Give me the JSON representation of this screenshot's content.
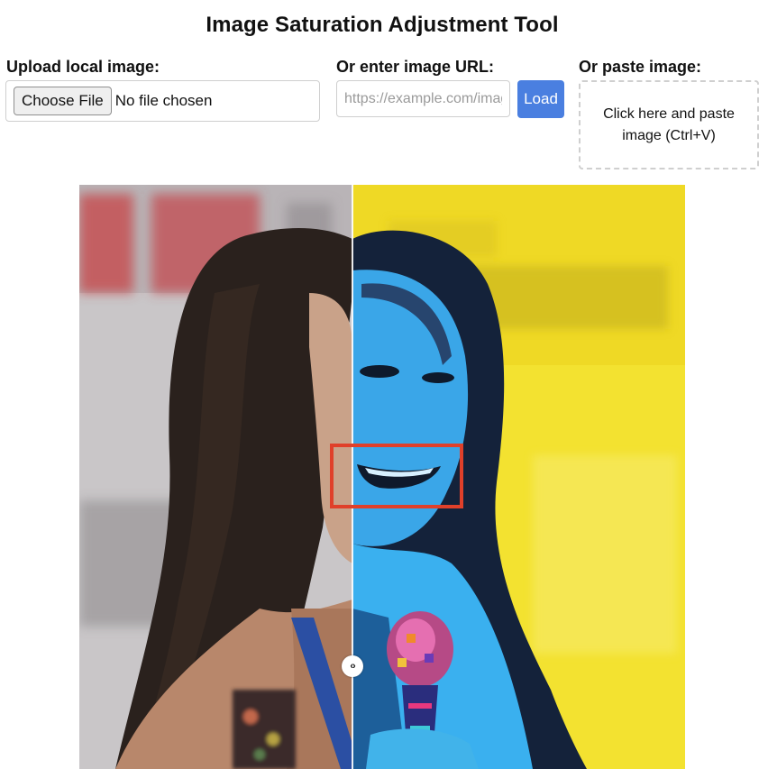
{
  "app": {
    "title": "Image Saturation Adjustment Tool"
  },
  "upload": {
    "label": "Upload local image:",
    "button_label": "Choose File",
    "status_text": "No file chosen"
  },
  "url": {
    "label": "Or enter image URL:",
    "placeholder": "https://example.com/image.jpg",
    "load_label": "Load"
  },
  "paste": {
    "label": "Or paste image:",
    "hint": "Click here and paste image (Ctrl+V)"
  },
  "compare": {
    "handle_glyph": "‹›",
    "highlight_color": "#e0402a",
    "accent_color": "#4a7fe0"
  }
}
